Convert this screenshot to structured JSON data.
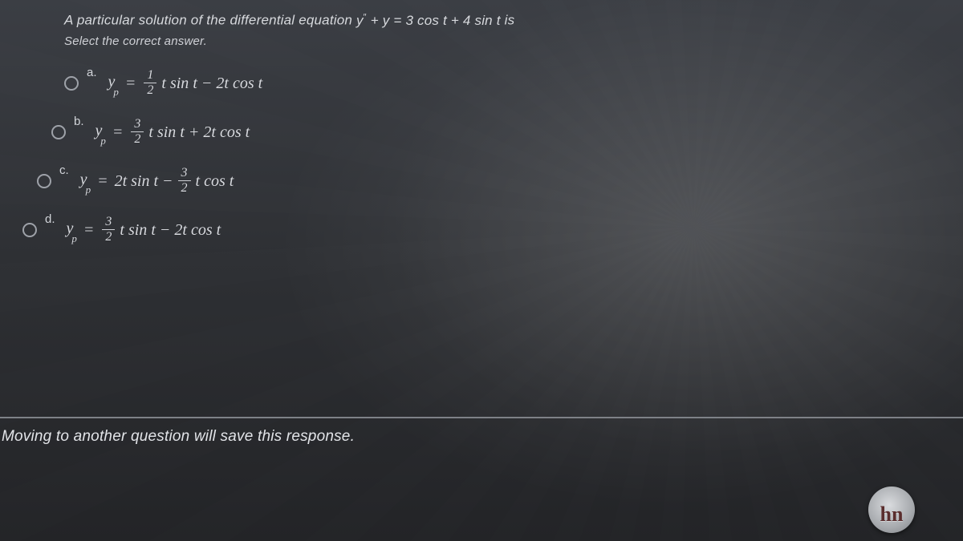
{
  "question": {
    "prompt_prefix": "A particular solution of the differential equation ",
    "equation_html": "y'' + y = 3 cos t + 4 sin t",
    "prompt_suffix": " is",
    "select_text": "Select the correct answer."
  },
  "options": [
    {
      "key": "a",
      "label": "a.",
      "frac_num": "1",
      "frac_den": "2",
      "before_frac": "y_p =",
      "after_frac": "t sin t − 2t cos t",
      "layout": "lead-frac"
    },
    {
      "key": "b",
      "label": "b.",
      "frac_num": "3",
      "frac_den": "2",
      "before_frac": "y_p =",
      "after_frac": "t sin t + 2t cos t",
      "layout": "lead-frac"
    },
    {
      "key": "c",
      "label": "c.",
      "frac_num": "3",
      "frac_den": "2",
      "before_frac": "y_p = 2t sin t −",
      "after_frac": "t cos t",
      "layout": "mid-frac"
    },
    {
      "key": "d",
      "label": "d.",
      "frac_num": "3",
      "frac_den": "2",
      "before_frac": "y_p =",
      "after_frac": "t sin t − 2t cos t",
      "layout": "lead-frac"
    }
  ],
  "footer": {
    "save_notice": "Moving to another question will save this response."
  },
  "watermark": {
    "text": "hn"
  }
}
